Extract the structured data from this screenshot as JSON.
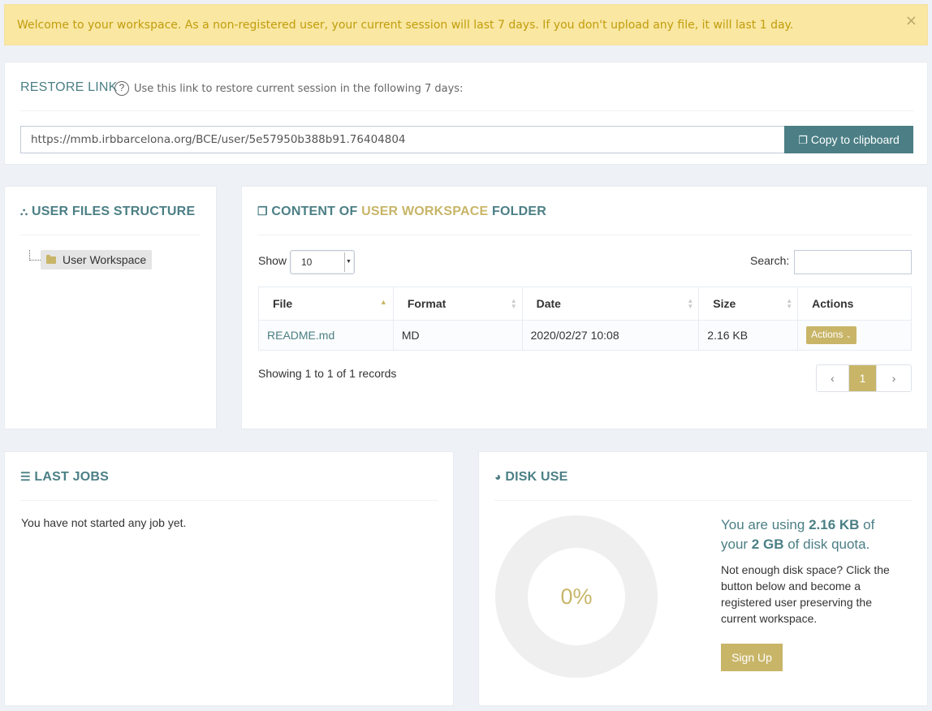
{
  "alert": {
    "message": "Welcome to your workspace. As a non-registered user, your current session will last 7 days. If you don't upload any file, it will last 1 day.",
    "close_glyph": "×"
  },
  "restore": {
    "title": "RESTORE LINK",
    "help_glyph": "?",
    "help_text": "Use this link to restore current session in the following 7 days:",
    "url": "https://mmb.irbbarcelona.org/BCE/user/5e57950b388b91.76404804",
    "copy_label": "Copy to clipboard"
  },
  "files_structure": {
    "title": "USER FILES STRUCTURE",
    "root_label": "User Workspace"
  },
  "content": {
    "title_prefix": "CONTENT OF ",
    "title_highlight": "USER WORKSPACE",
    "title_suffix": " FOLDER",
    "show_label": "Show",
    "page_size": "10",
    "search_label": "Search:",
    "search_value": "",
    "columns": [
      "File",
      "Format",
      "Date",
      "Size",
      "Actions"
    ],
    "rows": [
      {
        "file": "README.md",
        "format": "MD",
        "date": "2020/02/27 10:08",
        "size": "2.16 KB",
        "action_label": "Actions"
      }
    ],
    "info": "Showing 1 to 1 of 1 records",
    "pager": {
      "prev": "‹",
      "current": "1",
      "next": "›"
    }
  },
  "last_jobs": {
    "title": "LAST JOBS",
    "empty_text": "You have not started any job yet."
  },
  "disk_use": {
    "title": "DISK USE",
    "percent_label": "0%",
    "percent_value": 0,
    "usage_prefix": "You are using ",
    "used": "2.16 KB",
    "usage_mid": " of",
    "usage_line2_prefix": "your ",
    "quota": "2 GB",
    "usage_suffix": " of disk quota.",
    "more_text": "Not enough disk space? Click the button below and become a registered user preserving the current workspace.",
    "signup_label": "Sign Up"
  },
  "colors": {
    "accent_teal": "#4b7f85",
    "accent_gold": "#c8b568",
    "alert_bg": "#f9e7a2",
    "alert_text": "#c29d0b"
  },
  "icons": [
    "close-icon",
    "help-icon",
    "copy-icon",
    "sitemap-icon",
    "folder-icon",
    "copy-files-icon",
    "sort-icon",
    "chevron-down-icon",
    "list-icon",
    "pie-chart-icon"
  ]
}
